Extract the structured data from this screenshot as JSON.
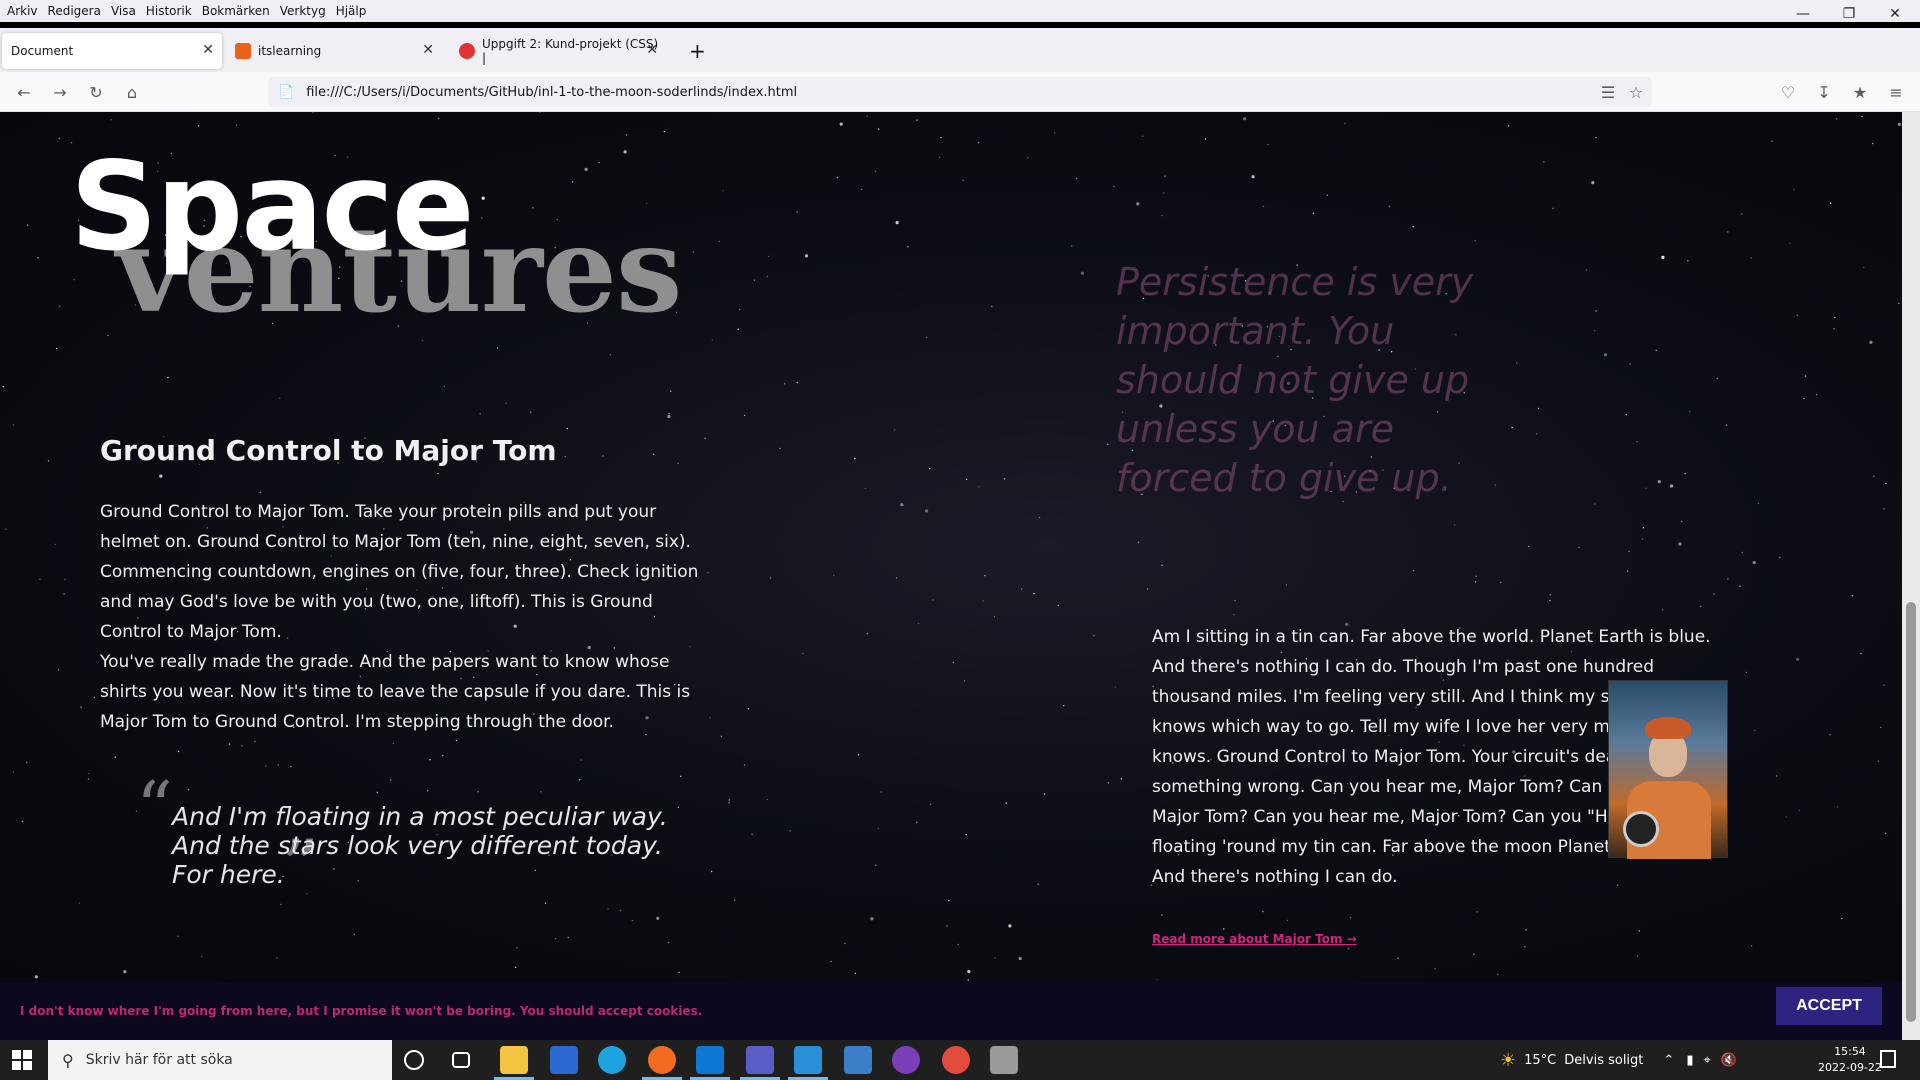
{
  "menubar": {
    "items": [
      "Arkiv",
      "Redigera",
      "Visa",
      "Historik",
      "Bokmärken",
      "Verktyg",
      "Hjälp"
    ],
    "window_controls": [
      "minimize",
      "restore",
      "close"
    ]
  },
  "tabs": [
    {
      "label": "Document",
      "active": true,
      "icon": ""
    },
    {
      "label": "itslearning",
      "active": false,
      "icon": "itslearning-icon"
    },
    {
      "label": "Uppgift 2: Kund-projekt (CSS) |",
      "active": false,
      "icon": "pin-icon"
    }
  ],
  "newtab_label": "+",
  "navbar": {
    "url": "file:///C:/Users/i/Documents/GitHub/inl-1-to-the-moon-soderlinds/index.html"
  },
  "page": {
    "logo_top": "Space",
    "logo_bottom": "ventures",
    "quote_right": "Persistence is very important. You should not give up unless you are forced to give up.",
    "section_left": {
      "heading": "Ground Control to Major Tom",
      "paragraph_1": "Ground Control to Major Tom. Take your protein pills and put your helmet on. Ground Control to Major Tom (ten, nine, eight, seven, six). Commencing countdown, engines on (five, four, three). Check ignition and may God's love be with you (two, one, liftoff). This is Ground Control to Major Tom.",
      "paragraph_2": "You've really made the grade. And the papers want to know whose shirts you wear. Now it's time to leave the capsule if you dare. This is Major Tom to Ground Control. I'm stepping through the door."
    },
    "float_quote": {
      "open_mark": "“",
      "close_mark": "”",
      "line_1": "And I'm floating in a most peculiar way.",
      "line_2": "And the stars look very different today.",
      "line_3": "For here."
    },
    "section_right": {
      "text": "Am I sitting in a tin can. Far above the world. Planet Earth is blue. And there's nothing I can do. Though I'm past one hundred thousand miles. I'm feeling very still. And I think my spaceship. knows which way to go. Tell my wife I love her very much she knows. Ground Control to Major Tom. Your circuit's dead, there's something wrong. Can you hear me, Major Tom? Can you hear me, Major Tom? Can you hear me, Major Tom? Can you \"Here am I floating 'round my tin can. Far above the moon Planet Earth is blue And there's nothing I can do.",
      "read_more": "Read more about Major Tom →"
    },
    "cookie": {
      "text": "I don't know where I'm going from here, but I promise it won't be boring. You should accept cookies.",
      "accept_label": "ACCEPT"
    }
  },
  "taskbar": {
    "search_placeholder": "Skriv här för att söka",
    "weather_temp": "15°C",
    "weather_text": "Delvis soligt",
    "time": "15:54",
    "date": "2022-09-22"
  },
  "colors": {
    "accent_pink": "#d4227f",
    "accept_button": "#2e2380",
    "cookie_bar": "#0b0820"
  }
}
